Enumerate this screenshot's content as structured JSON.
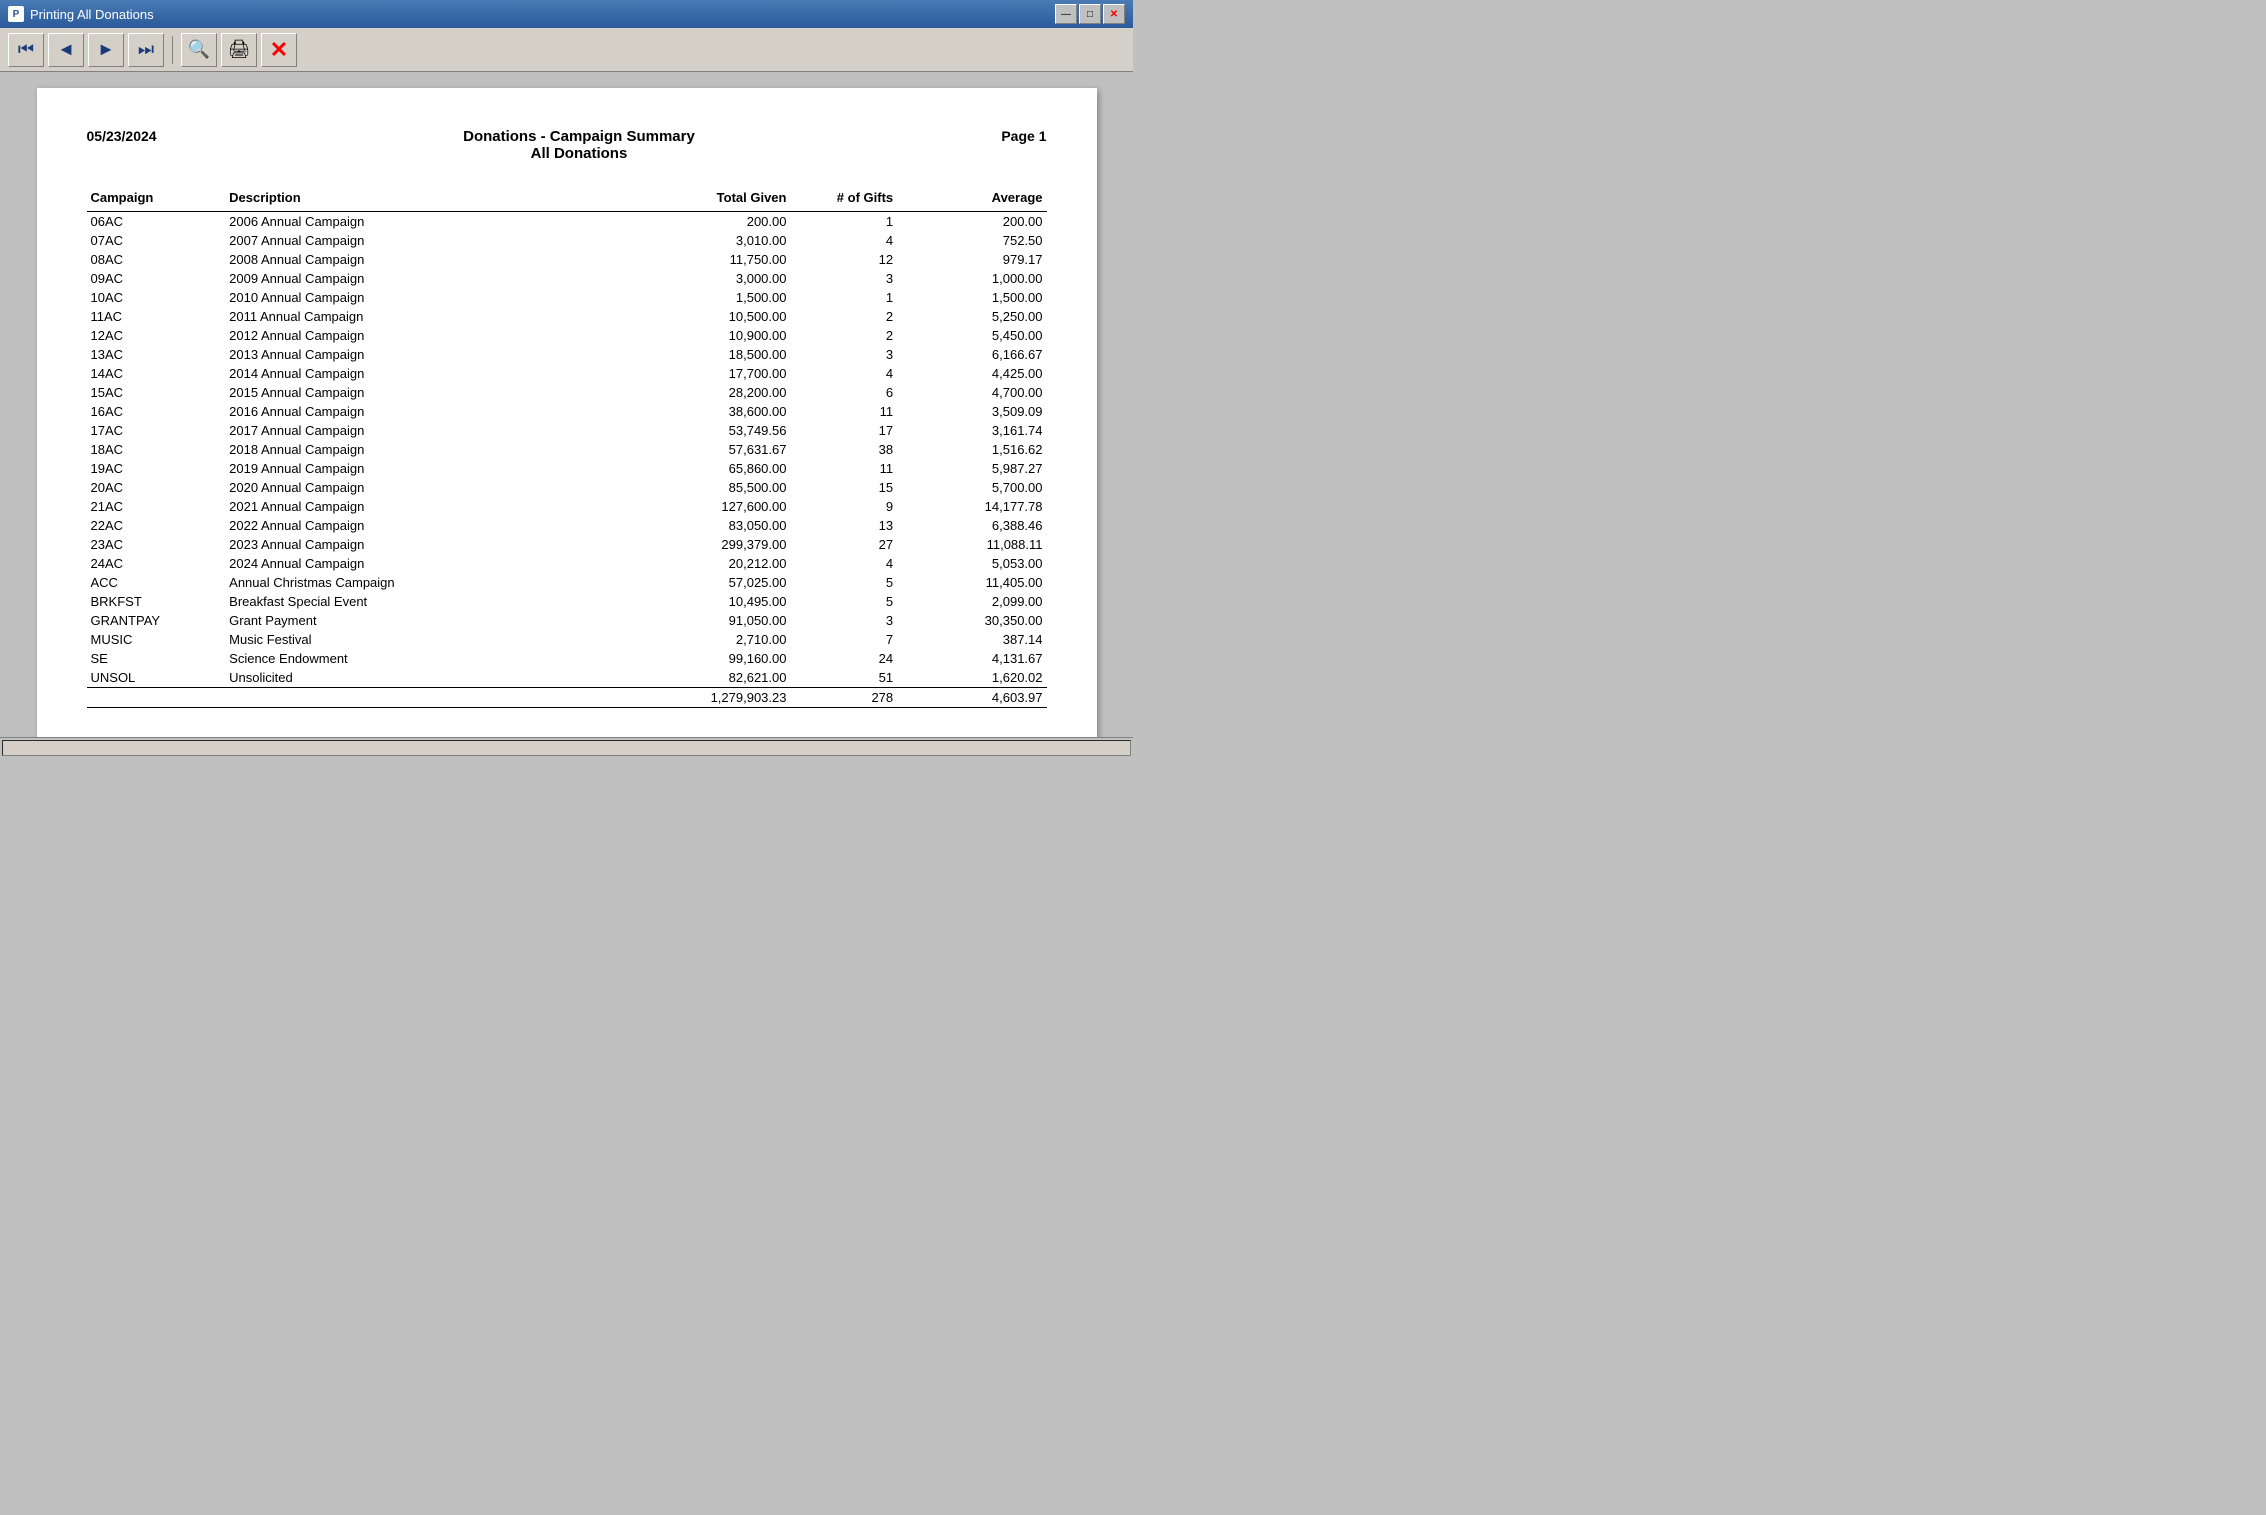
{
  "titleBar": {
    "title": "Printing All Donations",
    "minLabel": "—",
    "maxLabel": "□",
    "closeLabel": "✕"
  },
  "toolbar": {
    "firstBtn": "⏮",
    "prevBtn": "◀",
    "nextBtn": "▶",
    "lastBtn": "⏭",
    "searchBtn": "🔍",
    "printBtn": "🖨",
    "closeBtn": "✕"
  },
  "report": {
    "date": "05/23/2024",
    "title1": "Donations - Campaign Summary",
    "title2": "All Donations",
    "pageLabel": "Page 1",
    "columns": {
      "campaign": "Campaign",
      "description": "Description",
      "totalGiven": "Total Given",
      "numGifts": "# of Gifts",
      "average": "Average"
    },
    "rows": [
      {
        "campaign": "06AC",
        "description": "2006 Annual Campaign",
        "totalGiven": "200.00",
        "numGifts": "1",
        "average": "200.00"
      },
      {
        "campaign": "07AC",
        "description": "2007 Annual Campaign",
        "totalGiven": "3,010.00",
        "numGifts": "4",
        "average": "752.50"
      },
      {
        "campaign": "08AC",
        "description": "2008 Annual Campaign",
        "totalGiven": "11,750.00",
        "numGifts": "12",
        "average": "979.17"
      },
      {
        "campaign": "09AC",
        "description": "2009 Annual Campaign",
        "totalGiven": "3,000.00",
        "numGifts": "3",
        "average": "1,000.00"
      },
      {
        "campaign": "10AC",
        "description": "2010 Annual Campaign",
        "totalGiven": "1,500.00",
        "numGifts": "1",
        "average": "1,500.00"
      },
      {
        "campaign": "11AC",
        "description": "2011 Annual Campaign",
        "totalGiven": "10,500.00",
        "numGifts": "2",
        "average": "5,250.00"
      },
      {
        "campaign": "12AC",
        "description": "2012 Annual Campaign",
        "totalGiven": "10,900.00",
        "numGifts": "2",
        "average": "5,450.00"
      },
      {
        "campaign": "13AC",
        "description": "2013 Annual Campaign",
        "totalGiven": "18,500.00",
        "numGifts": "3",
        "average": "6,166.67"
      },
      {
        "campaign": "14AC",
        "description": "2014 Annual Campaign",
        "totalGiven": "17,700.00",
        "numGifts": "4",
        "average": "4,425.00"
      },
      {
        "campaign": "15AC",
        "description": "2015 Annual Campaign",
        "totalGiven": "28,200.00",
        "numGifts": "6",
        "average": "4,700.00"
      },
      {
        "campaign": "16AC",
        "description": "2016 Annual Campaign",
        "totalGiven": "38,600.00",
        "numGifts": "11",
        "average": "3,509.09"
      },
      {
        "campaign": "17AC",
        "description": "2017 Annual Campaign",
        "totalGiven": "53,749.56",
        "numGifts": "17",
        "average": "3,161.74"
      },
      {
        "campaign": "18AC",
        "description": "2018 Annual Campaign",
        "totalGiven": "57,631.67",
        "numGifts": "38",
        "average": "1,516.62"
      },
      {
        "campaign": "19AC",
        "description": "2019 Annual Campaign",
        "totalGiven": "65,860.00",
        "numGifts": "11",
        "average": "5,987.27"
      },
      {
        "campaign": "20AC",
        "description": "2020 Annual Campaign",
        "totalGiven": "85,500.00",
        "numGifts": "15",
        "average": "5,700.00"
      },
      {
        "campaign": "21AC",
        "description": "2021 Annual Campaign",
        "totalGiven": "127,600.00",
        "numGifts": "9",
        "average": "14,177.78"
      },
      {
        "campaign": "22AC",
        "description": "2022 Annual Campaign",
        "totalGiven": "83,050.00",
        "numGifts": "13",
        "average": "6,388.46"
      },
      {
        "campaign": "23AC",
        "description": "2023 Annual Campaign",
        "totalGiven": "299,379.00",
        "numGifts": "27",
        "average": "11,088.11"
      },
      {
        "campaign": "24AC",
        "description": "2024 Annual Campaign",
        "totalGiven": "20,212.00",
        "numGifts": "4",
        "average": "5,053.00"
      },
      {
        "campaign": "ACC",
        "description": "Annual Christmas Campaign",
        "totalGiven": "57,025.00",
        "numGifts": "5",
        "average": "11,405.00"
      },
      {
        "campaign": "BRKFST",
        "description": "Breakfast Special Event",
        "totalGiven": "10,495.00",
        "numGifts": "5",
        "average": "2,099.00"
      },
      {
        "campaign": "GRANTPAY",
        "description": "Grant Payment",
        "totalGiven": "91,050.00",
        "numGifts": "3",
        "average": "30,350.00"
      },
      {
        "campaign": "MUSIC",
        "description": "Music Festival",
        "totalGiven": "2,710.00",
        "numGifts": "7",
        "average": "387.14"
      },
      {
        "campaign": "SE",
        "description": "Science Endowment",
        "totalGiven": "99,160.00",
        "numGifts": "24",
        "average": "4,131.67"
      },
      {
        "campaign": "UNSOL",
        "description": "Unsolicited",
        "totalGiven": "82,621.00",
        "numGifts": "51",
        "average": "1,620.02"
      }
    ],
    "totals": {
      "totalGiven": "1,279,903.23",
      "numGifts": "278",
      "average": "4,603.97"
    }
  }
}
